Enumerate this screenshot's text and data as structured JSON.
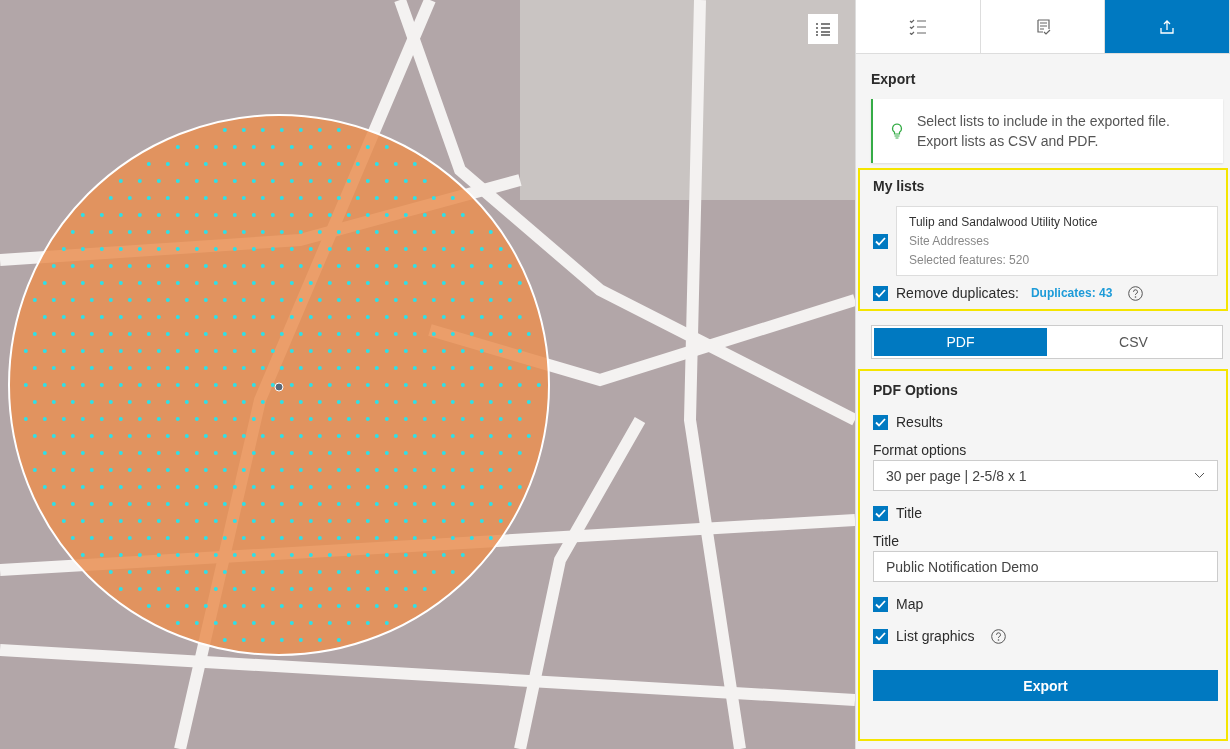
{
  "tabs": [
    {
      "kind": "checklist",
      "selected": false
    },
    {
      "kind": "document",
      "selected": false
    },
    {
      "kind": "export",
      "selected": true
    }
  ],
  "export": {
    "title": "Export",
    "tip_lines": [
      "Select lists to include in the exported file.",
      "Export lists as CSV and PDF."
    ]
  },
  "my_lists": {
    "title": "My lists",
    "lists": [
      {
        "name": "Tulip and Sandalwood Utility Notice",
        "layer": "Site Addresses",
        "count": "Selected features: 520",
        "checked": true
      }
    ],
    "remove_duplicates": {
      "label": "Remove duplicates:",
      "checked": true
    },
    "duplicates": "Duplicates: 43"
  },
  "format_toggle": [
    {
      "label": "PDF",
      "selected": true
    },
    {
      "label": "CSV",
      "selected": false
    }
  ],
  "pdf_options": {
    "title": "PDF Options",
    "results": {
      "label": "Results",
      "checked": true
    },
    "format_options": {
      "label": "Format options",
      "value": "30 per page | 2-5/8 x 1"
    },
    "title_check": {
      "label": "Title",
      "checked": true
    },
    "title_field": {
      "label": "Title",
      "value": "Public Notification Demo"
    },
    "map": {
      "label": "Map",
      "checked": true
    },
    "list_graphics": {
      "label": "List graphics",
      "checked": true
    },
    "export_button": "Export"
  }
}
